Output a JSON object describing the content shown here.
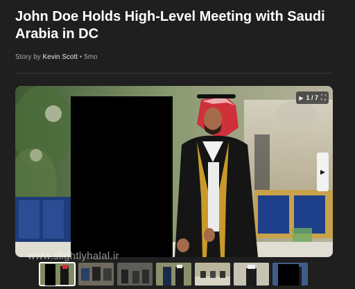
{
  "article": {
    "title": "John Doe Holds High-Level Meeting with Saudi Arabia in DC",
    "byline_prefix": "Story by",
    "author": "Kevin Scott",
    "age": "5mo"
  },
  "gallery": {
    "counter": "1 / 7",
    "play_icon": "play-icon",
    "expand_icon": "expand-icon",
    "next_icon": "next-arrow-icon",
    "thumbnail_count": 7,
    "active_thumbnail": 1
  },
  "watermark": "www.slightlyhalal.ir"
}
